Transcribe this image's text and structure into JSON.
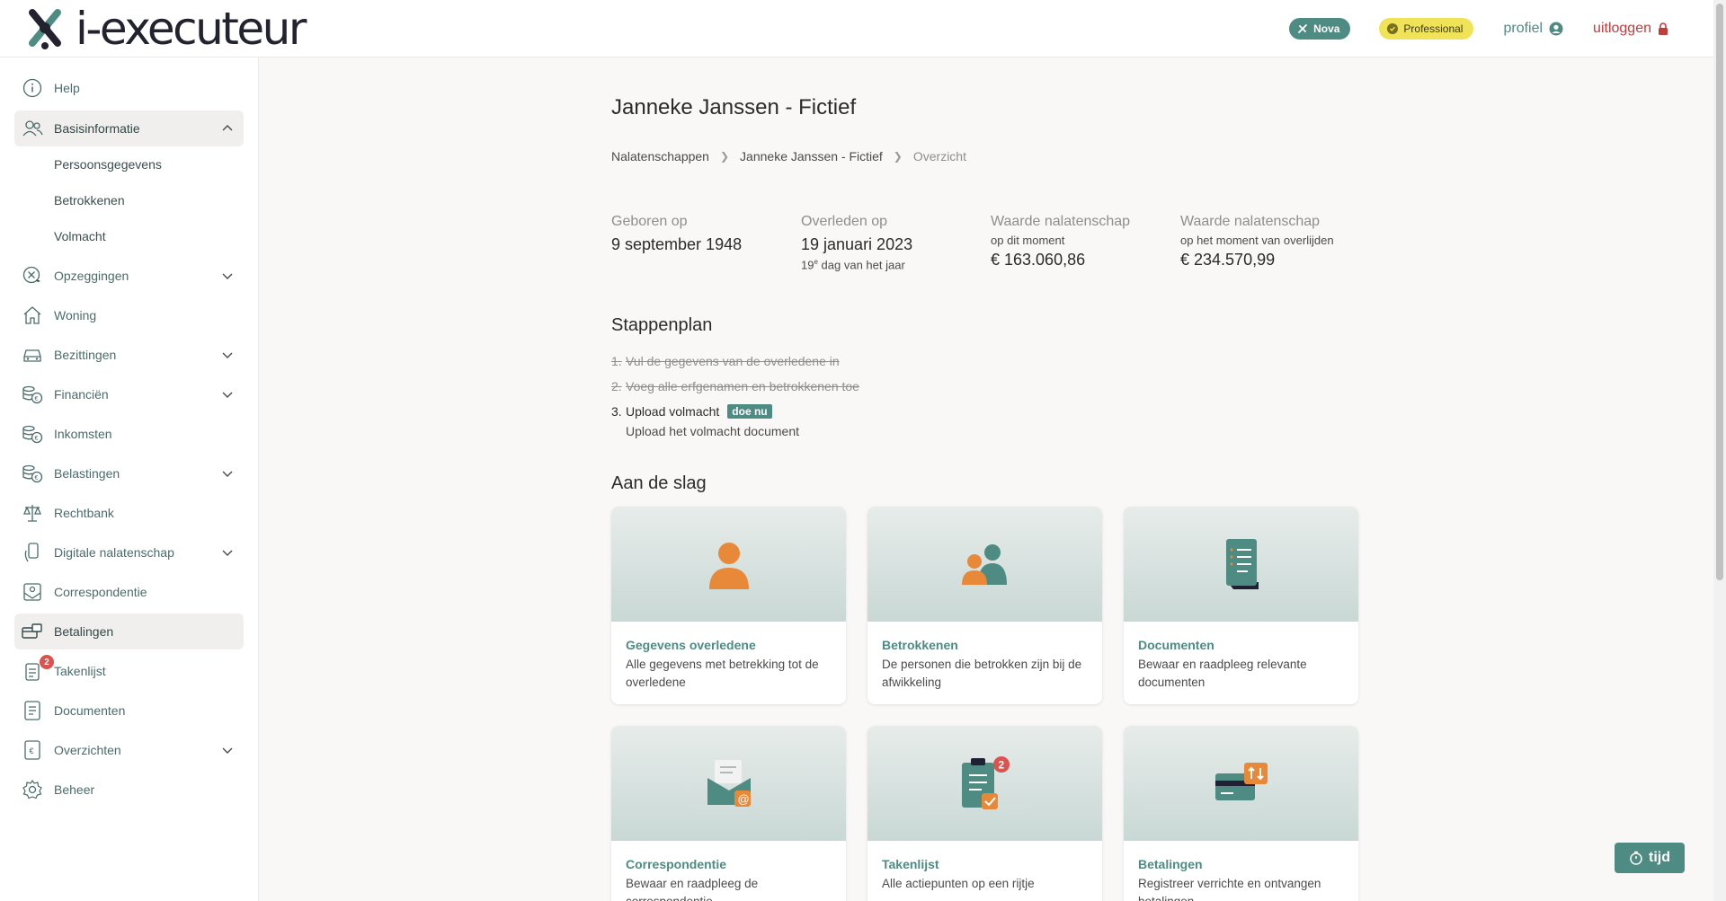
{
  "header": {
    "logo_text": "i-executeur",
    "badge_nova": "Nova",
    "badge_pro": "Professional",
    "profiel": "profiel",
    "logout": "uitloggen"
  },
  "sidebar": {
    "help": "Help",
    "basisinformatie": "Basisinformatie",
    "sub_persoons": "Persoonsgegevens",
    "sub_betrokkenen": "Betrokkenen",
    "sub_volmacht": "Volmacht",
    "opzeggingen": "Opzeggingen",
    "woning": "Woning",
    "bezittingen": "Bezittingen",
    "financien": "Financiën",
    "inkomsten": "Inkomsten",
    "belastingen": "Belastingen",
    "rechtbank": "Rechtbank",
    "digitale": "Digitale nalatenschap",
    "correspondentie": "Correspondentie",
    "betalingen": "Betalingen",
    "takenlijst": "Takenlijst",
    "takenlijst_badge": "2",
    "documenten": "Documenten",
    "overzichten": "Overzichten",
    "beheer": "Beheer"
  },
  "main": {
    "title": "Janneke Janssen - Fictief",
    "breadcrumb": [
      "Nalatenschappen",
      "Janneke Janssen - Fictief",
      "Overzicht"
    ],
    "facts": {
      "born_label": "Geboren op",
      "born_value": "9 september 1948",
      "died_label": "Overleden op",
      "died_value": "19 januari 2023",
      "died_sub_num": "19",
      "died_sub_sup": "e",
      "died_sub_rest": " dag van het jaar",
      "now_label": "Waarde nalatenschap",
      "now_sub": "op dit moment",
      "now_value": "€ 163.060,86",
      "death_label": "Waarde nalatenschap",
      "death_sub": "op het moment van overlijden",
      "death_value": "€ 234.570,99"
    },
    "stappenplan_title": "Stappenplan",
    "steps": {
      "s1_num": "1.",
      "s1": "Vul de gegevens van de overledene in",
      "s2_num": "2.",
      "s2": "Voeg alle erfgenamen en betrokkenen toe",
      "s3_num": "3.",
      "s3": "Upload volmacht",
      "s3_action": "doe nu",
      "s3_sub": "Upload het volmacht document"
    },
    "aan_de_slag_title": "Aan de slag",
    "cards": {
      "c1_title": "Gegevens overledene",
      "c1_desc": "Alle gegevens met betrekking tot de overledene",
      "c2_title": "Betrokkenen",
      "c2_desc": "De personen die betrokken zijn bij de afwikkeling",
      "c3_title": "Documenten",
      "c3_desc": "Bewaar en raadpleeg relevante documenten",
      "c4_title": "Correspondentie",
      "c4_desc": "Bewaar en raadpleeg de correspondentie",
      "c5_title": "Takenlijst",
      "c5_desc": "Alle actiepunten op een rijtje",
      "c5_badge": "2",
      "c6_title": "Betalingen",
      "c6_desc": "Registreer verrichte en ontvangen betalingen"
    }
  },
  "tijd_button": "tijd",
  "colors": {
    "accent": "#4e8b82",
    "orange": "#e8893a",
    "logout_red": "#c23c3c",
    "pro_yellow": "#f1e357"
  }
}
